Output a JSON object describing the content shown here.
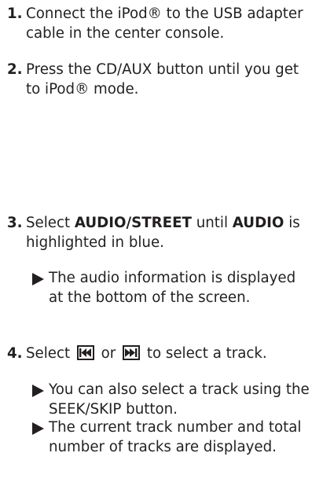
{
  "steps": [
    {
      "num": "1.",
      "text": "Connect the iPod® to the USB adapter cable in the center console."
    },
    {
      "num": "2.",
      "text": "Press the CD/AUX button until you get to iPod® mode."
    },
    {
      "num": "3.",
      "pre": "Select ",
      "bold1": "AUDIO/STREET",
      "mid": " until ",
      "bold2": "AUDIO",
      "post": " is highlighted in blue."
    },
    {
      "num": "4.",
      "pre": "Select ",
      "mid": " or ",
      "post": " to select a track."
    }
  ],
  "notes": [
    "The audio information is displayed at the bottom of the screen.",
    "You can also select a track using the SEEK/SKIP button.",
    "The current track number and total number of tracks are displayed."
  ],
  "icons": [
    "skip-back-icon",
    "skip-forward-icon",
    "triangle-bullet-icon"
  ]
}
